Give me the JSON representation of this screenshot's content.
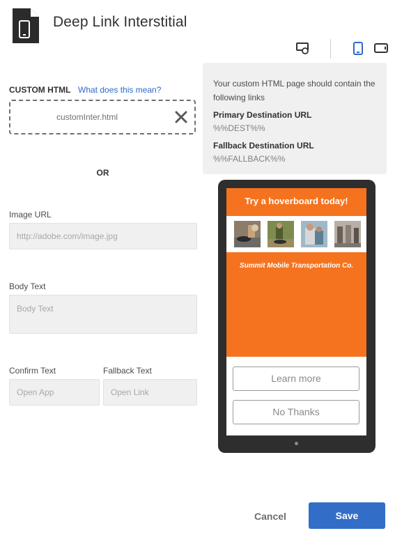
{
  "header": {
    "title": "Deep Link Interstitial",
    "icon": "document-mobile-icon"
  },
  "toolbar": {
    "refresh_icon": "refresh-preview-icon",
    "phone_icon": "phone-portrait-icon",
    "tablet_icon": "tablet-landscape-icon",
    "active_color": "#2d6ac8"
  },
  "form": {
    "custom_html_label": "CUSTOM HTML",
    "help_link": "What does this mean?",
    "uploaded_file": "customInter.html",
    "or_label": "OR",
    "image_url_label": "Image URL",
    "image_url_placeholder": "http://adobe.com/image.jpg",
    "body_text_label": "Body Text",
    "body_text_placeholder": "Body Text",
    "confirm_text_label": "Confirm Text",
    "confirm_text_placeholder": "Open App",
    "fallback_text_label": "Fallback Text",
    "fallback_text_placeholder": "Open Link"
  },
  "info": {
    "intro": "Your custom HTML page should contain the following links",
    "primary_heading": "Primary Destination URL",
    "primary_value": "%%DEST%%",
    "fallback_heading": "Fallback Destination URL",
    "fallback_value": "%%FALLBACK%%"
  },
  "preview": {
    "headline": "Try a hoverboard today!",
    "company": "Summit Mobile Transportation Co.",
    "learn_more": "Learn more",
    "no_thanks": "No Thanks",
    "accent_color": "#f5731f"
  },
  "footer": {
    "cancel": "Cancel",
    "save": "Save",
    "save_color": "#326ec8"
  }
}
